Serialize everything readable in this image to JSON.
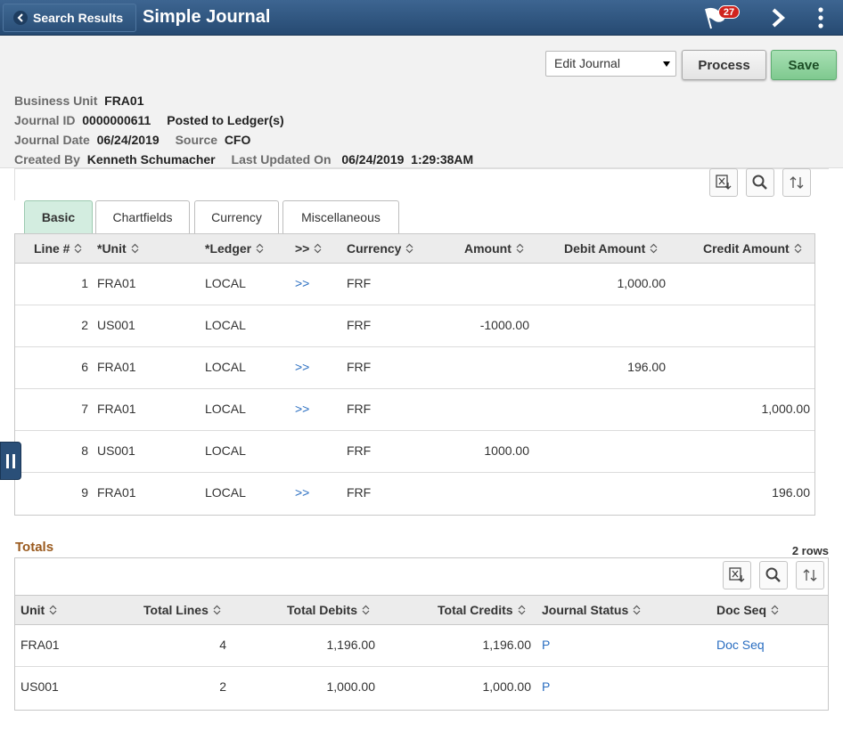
{
  "header": {
    "back_label": "Search Results",
    "title": "Simple Journal",
    "notification_count": "27"
  },
  "toolbar": {
    "action_selected": "Edit Journal",
    "process_label": "Process",
    "save_label": "Save"
  },
  "journal": {
    "business_unit_label": "Business Unit",
    "business_unit": "FRA01",
    "journal_id_label": "Journal ID",
    "journal_id": "0000000611",
    "status": "Posted to Ledger(s)",
    "journal_date_label": "Journal Date",
    "journal_date": "06/24/2019",
    "source_label": "Source",
    "source": "CFO",
    "created_by_label": "Created By",
    "created_by": "Kenneth Schumacher",
    "last_updated_label": "Last Updated On",
    "last_updated": "06/24/2019  1:29:38AM"
  },
  "tabs": [
    {
      "label": "Basic"
    },
    {
      "label": "Chartfields"
    },
    {
      "label": "Currency"
    },
    {
      "label": "Miscellaneous"
    }
  ],
  "lines": {
    "columns": [
      "Line #",
      "*Unit",
      "*Ledger",
      ">>",
      "Currency",
      "Amount",
      "Debit Amount",
      "Credit Amount"
    ],
    "rows": [
      {
        "line": "1",
        "unit": "FRA01",
        "ledger": "LOCAL",
        "more": ">>",
        "currency": "FRF",
        "amount": "",
        "debit": "1,000.00",
        "credit": ""
      },
      {
        "line": "2",
        "unit": "US001",
        "ledger": "LOCAL",
        "more": "",
        "currency": "FRF",
        "amount": "-1000.00",
        "debit": "",
        "credit": ""
      },
      {
        "line": "6",
        "unit": "FRA01",
        "ledger": "LOCAL",
        "more": ">>",
        "currency": "FRF",
        "amount": "",
        "debit": "196.00",
        "credit": ""
      },
      {
        "line": "7",
        "unit": "FRA01",
        "ledger": "LOCAL",
        "more": ">>",
        "currency": "FRF",
        "amount": "",
        "debit": "",
        "credit": "1,000.00"
      },
      {
        "line": "8",
        "unit": "US001",
        "ledger": "LOCAL",
        "more": "",
        "currency": "FRF",
        "amount": "1000.00",
        "debit": "",
        "credit": ""
      },
      {
        "line": "9",
        "unit": "FRA01",
        "ledger": "LOCAL",
        "more": ">>",
        "currency": "FRF",
        "amount": "",
        "debit": "",
        "credit": "196.00"
      }
    ]
  },
  "totals": {
    "title": "Totals",
    "row_count": "2 rows",
    "columns": [
      "Unit",
      "Total Lines",
      "Total Debits",
      "Total Credits",
      "Journal Status",
      "Doc Seq"
    ],
    "rows": [
      {
        "unit": "FRA01",
        "lines": "4",
        "debits": "1,196.00",
        "credits": "1,196.00",
        "status": "P",
        "docseq": "Doc Seq"
      },
      {
        "unit": "US001",
        "lines": "2",
        "debits": "1,000.00",
        "credits": "1,000.00",
        "status": "P",
        "docseq": ""
      }
    ]
  },
  "colors": {
    "banner": "#2f5681",
    "save": "#8fd39e",
    "active_tab": "#d3ede0",
    "link": "#2a6ec1",
    "totals_title": "#9a5a1e"
  }
}
